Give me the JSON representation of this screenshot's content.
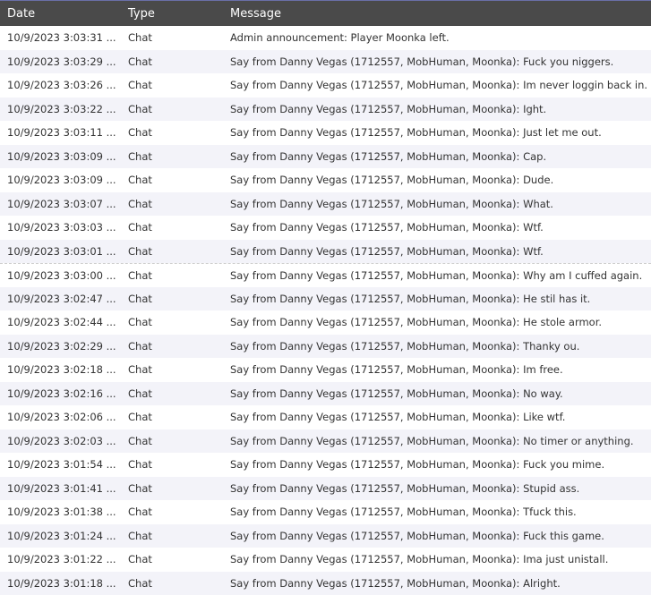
{
  "header": {
    "date": "Date",
    "type": "Type",
    "message": "Message"
  },
  "rows": [
    {
      "date": "10/9/2023 3:03:31 ...",
      "type": "Chat",
      "message": "Admin announcement: Player Moonka left."
    },
    {
      "date": "10/9/2023 3:03:29 ...",
      "type": "Chat",
      "message": "Say from Danny Vegas (1712557, MobHuman, Moonka): Fuck you niggers."
    },
    {
      "date": "10/9/2023 3:03:26 ...",
      "type": "Chat",
      "message": "Say from Danny Vegas (1712557, MobHuman, Moonka): Im never loggin back in."
    },
    {
      "date": "10/9/2023 3:03:22 ...",
      "type": "Chat",
      "message": "Say from Danny Vegas (1712557, MobHuman, Moonka): Ight."
    },
    {
      "date": "10/9/2023 3:03:11 ...",
      "type": "Chat",
      "message": "Say from Danny Vegas (1712557, MobHuman, Moonka): Just let me out."
    },
    {
      "date": "10/9/2023 3:03:09 ...",
      "type": "Chat",
      "message": "Say from Danny Vegas (1712557, MobHuman, Moonka): Cap."
    },
    {
      "date": "10/9/2023 3:03:09 ...",
      "type": "Chat",
      "message": "Say from Danny Vegas (1712557, MobHuman, Moonka): Dude."
    },
    {
      "date": "10/9/2023 3:03:07 ...",
      "type": "Chat",
      "message": "Say from Danny Vegas (1712557, MobHuman, Moonka): What."
    },
    {
      "date": "10/9/2023 3:03:03 ...",
      "type": "Chat",
      "message": "Say from Danny Vegas (1712557, MobHuman, Moonka): Wtf."
    },
    {
      "date": "10/9/2023 3:03:01 ...",
      "type": "Chat",
      "message": "Say from Danny Vegas (1712557, MobHuman, Moonka): Wtf."
    },
    {
      "date": "10/9/2023 3:03:00 ...",
      "type": "Chat",
      "message": "Say from Danny Vegas (1712557, MobHuman, Moonka): Why am I cuffed again."
    },
    {
      "date": "10/9/2023 3:02:47 ...",
      "type": "Chat",
      "message": "Say from Danny Vegas (1712557, MobHuman, Moonka): He stil has it."
    },
    {
      "date": "10/9/2023 3:02:44 ...",
      "type": "Chat",
      "message": "Say from Danny Vegas (1712557, MobHuman, Moonka): He stole armor."
    },
    {
      "date": "10/9/2023 3:02:29 ...",
      "type": "Chat",
      "message": "Say from Danny Vegas (1712557, MobHuman, Moonka): Thanky ou."
    },
    {
      "date": "10/9/2023 3:02:18 ...",
      "type": "Chat",
      "message": "Say from Danny Vegas (1712557, MobHuman, Moonka): Im free."
    },
    {
      "date": "10/9/2023 3:02:16 ...",
      "type": "Chat",
      "message": "Say from Danny Vegas (1712557, MobHuman, Moonka): No way."
    },
    {
      "date": "10/9/2023 3:02:06 ...",
      "type": "Chat",
      "message": "Say from Danny Vegas (1712557, MobHuman, Moonka): Like wtf."
    },
    {
      "date": "10/9/2023 3:02:03 ...",
      "type": "Chat",
      "message": "Say from Danny Vegas (1712557, MobHuman, Moonka): No timer or anything."
    },
    {
      "date": "10/9/2023 3:01:54 ...",
      "type": "Chat",
      "message": "Say from Danny Vegas (1712557, MobHuman, Moonka): Fuck you mime."
    },
    {
      "date": "10/9/2023 3:01:41 ...",
      "type": "Chat",
      "message": "Say from Danny Vegas (1712557, MobHuman, Moonka): Stupid ass."
    },
    {
      "date": "10/9/2023 3:01:38 ...",
      "type": "Chat",
      "message": "Say from Danny Vegas (1712557, MobHuman, Moonka): Tfuck this."
    },
    {
      "date": "10/9/2023 3:01:24 ...",
      "type": "Chat",
      "message": "Say from Danny Vegas (1712557, MobHuman, Moonka): Fuck this game."
    },
    {
      "date": "10/9/2023 3:01:22 ...",
      "type": "Chat",
      "message": "Say from Danny Vegas (1712557, MobHuman, Moonka): Ima just unistall."
    },
    {
      "date": "10/9/2023 3:01:18 ...",
      "type": "Chat",
      "message": "Say from Danny Vegas (1712557, MobHuman, Moonka): Alright."
    }
  ]
}
